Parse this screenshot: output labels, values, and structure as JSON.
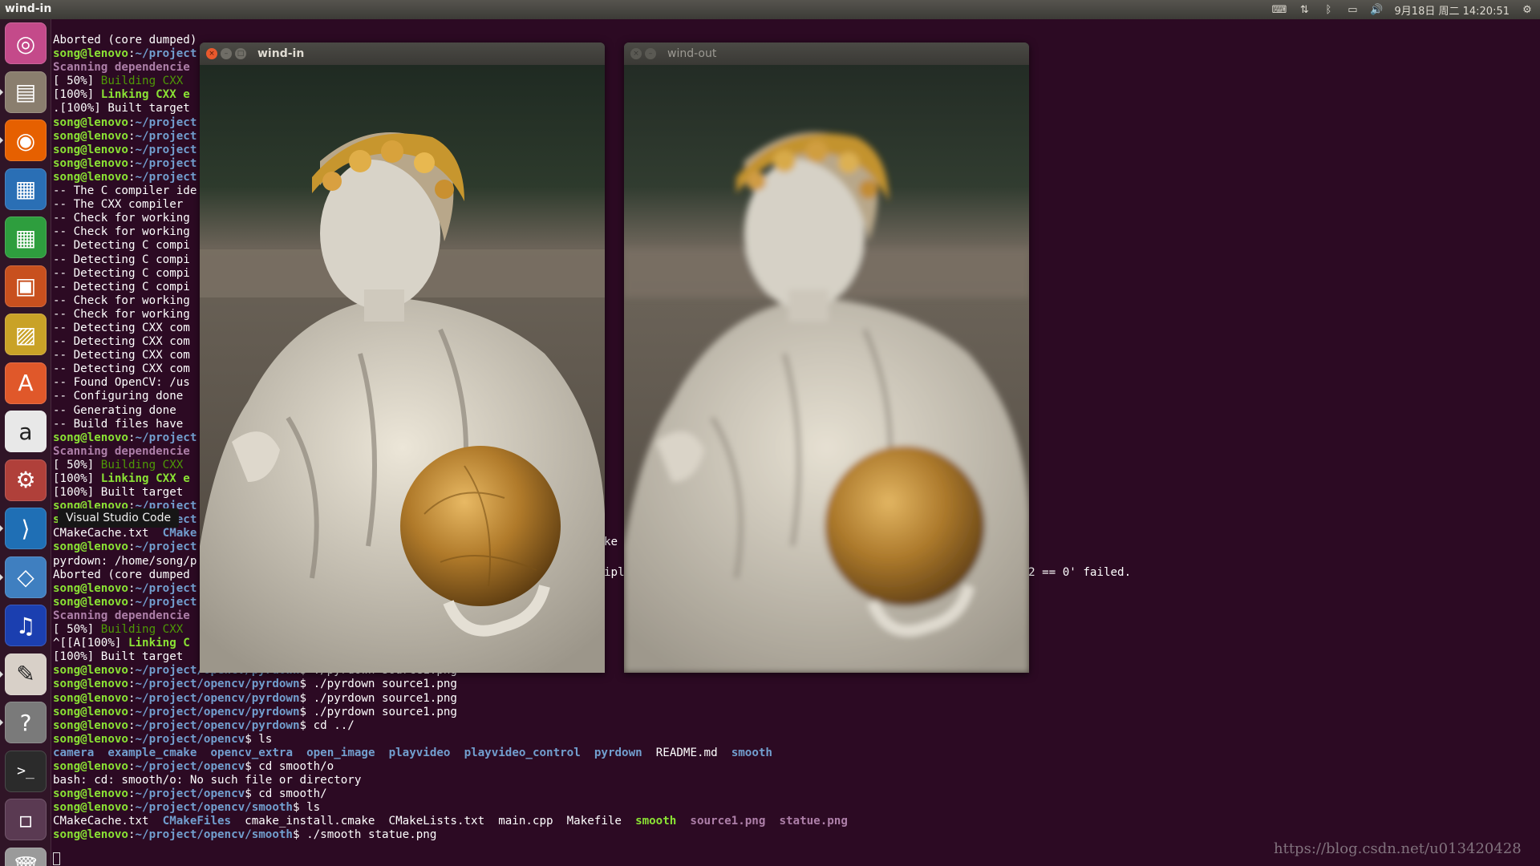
{
  "top_panel": {
    "app_title": "wind-in",
    "datetime": "9月18日 周二 14:20:51",
    "tray": [
      "keyboard-icon",
      "network-icon",
      "bluetooth-icon",
      "battery-icon",
      "volume-icon"
    ]
  },
  "launcher": {
    "items": [
      {
        "name": "ubuntu-dash",
        "icon": "ubuntu-logo-icon",
        "color": "#c44a8a"
      },
      {
        "name": "files",
        "icon": "file-cabinet-icon",
        "color": "#8a7e6e"
      },
      {
        "name": "firefox",
        "icon": "firefox-icon",
        "color": "#e66000"
      },
      {
        "name": "libreoffice-writer",
        "icon": "document-icon",
        "color": "#2a6fb5"
      },
      {
        "name": "libreoffice-calc",
        "icon": "spreadsheet-icon",
        "color": "#2e9e3e"
      },
      {
        "name": "libreoffice-impress",
        "icon": "presentation-icon",
        "color": "#c8501e"
      },
      {
        "name": "image-viewer",
        "icon": "picture-icon",
        "color": "#c9a227"
      },
      {
        "name": "software-center",
        "icon": "shopping-bag-icon",
        "color": "#e0582a"
      },
      {
        "name": "amazon",
        "icon": "amazon-icon",
        "color": "#e8e8e8"
      },
      {
        "name": "system-settings",
        "icon": "wrench-gear-icon",
        "color": "#b0403a"
      },
      {
        "name": "visual-studio-code",
        "icon": "vscode-icon",
        "color": "#1f6fb5"
      },
      {
        "name": "virtualbox",
        "icon": "cube-icon",
        "color": "#3f7fc0"
      },
      {
        "name": "audacity",
        "icon": "headphones-icon",
        "color": "#1b3fb0"
      },
      {
        "name": "pdf-viewer",
        "icon": "pdf-icon",
        "color": "#d8d0c8"
      },
      {
        "name": "help",
        "icon": "question-icon",
        "color": "#7a7a7a"
      },
      {
        "name": "terminal",
        "icon": "terminal-icon",
        "color": "#2b2b2b"
      },
      {
        "name": "workspaces",
        "icon": "workspace-icon",
        "color": "#5a3a52"
      },
      {
        "name": "trash",
        "icon": "trash-icon",
        "color": "#9a9a9a"
      }
    ],
    "tooltip": "Visual Studio Code"
  },
  "terminal": {
    "lines": [
      [
        {
          "t": "Aborted (core dumped)"
        }
      ],
      [
        {
          "t": "song@lenovo",
          "c": "ps"
        },
        {
          "t": ":"
        },
        {
          "t": "~/project",
          "c": "pp"
        }
      ],
      [
        {
          "t": "Scanning dependencie",
          "c": "mag"
        }
      ],
      [
        {
          "t": "[ 50%] "
        },
        {
          "t": "Building CXX ",
          "c": "grn"
        }
      ],
      [
        {
          "t": "[100%] "
        },
        {
          "t": "Linking CXX e",
          "c": "grnb"
        }
      ],
      [
        {
          "t": ".[100%] Built target"
        }
      ],
      [
        {
          "t": "song@lenovo",
          "c": "ps"
        },
        {
          "t": ":"
        },
        {
          "t": "~/project",
          "c": "pp"
        }
      ],
      [
        {
          "t": "song@lenovo",
          "c": "ps"
        },
        {
          "t": ":"
        },
        {
          "t": "~/project",
          "c": "pp"
        }
      ],
      [
        {
          "t": "song@lenovo",
          "c": "ps"
        },
        {
          "t": ":"
        },
        {
          "t": "~/project",
          "c": "pp"
        }
      ],
      [
        {
          "t": "song@lenovo",
          "c": "ps"
        },
        {
          "t": ":"
        },
        {
          "t": "~/project",
          "c": "pp"
        }
      ],
      [
        {
          "t": "song@lenovo",
          "c": "ps"
        },
        {
          "t": ":"
        },
        {
          "t": "~/project",
          "c": "pp"
        }
      ],
      [
        {
          "t": "-- The C compiler ide"
        }
      ],
      [
        {
          "t": "-- The CXX compiler "
        }
      ],
      [
        {
          "t": "-- Check for working"
        }
      ],
      [
        {
          "t": "-- Check for working"
        }
      ],
      [
        {
          "t": "-- Detecting C compi"
        }
      ],
      [
        {
          "t": "-- Detecting C compi"
        }
      ],
      [
        {
          "t": "-- Detecting C compi"
        }
      ],
      [
        {
          "t": "-- Detecting C compi"
        }
      ],
      [
        {
          "t": "-- Check for working"
        }
      ],
      [
        {
          "t": "-- Check for working"
        }
      ],
      [
        {
          "t": "-- Detecting CXX com"
        }
      ],
      [
        {
          "t": "-- Detecting CXX com"
        }
      ],
      [
        {
          "t": "-- Detecting CXX com"
        }
      ],
      [
        {
          "t": "-- Detecting CXX com"
        }
      ],
      [
        {
          "t": "-- Found OpenCV: /us"
        }
      ],
      [
        {
          "t": "-- Configuring done"
        }
      ],
      [
        {
          "t": "-- Generating done"
        }
      ],
      [
        {
          "t": "-- Build files have "
        }
      ],
      [
        {
          "t": "song@lenovo",
          "c": "ps"
        },
        {
          "t": ":"
        },
        {
          "t": "~/project",
          "c": "pp"
        }
      ],
      [
        {
          "t": "Scanning dependencie",
          "c": "mag"
        }
      ],
      [
        {
          "t": "[ 50%] "
        },
        {
          "t": "Building CXX ",
          "c": "grn"
        }
      ],
      [
        {
          "t": "[100%] "
        },
        {
          "t": "Linking CXX e",
          "c": "grnb"
        }
      ],
      [
        {
          "t": "[100%] Built target "
        }
      ],
      [
        {
          "t": "song@lenovo",
          "c": "ps"
        },
        {
          "t": ":"
        },
        {
          "t": "~/project",
          "c": "pp"
        }
      ],
      [
        {
          "t": "song@lenovo",
          "c": "ps"
        },
        {
          "t": ":"
        },
        {
          "t": "~/project",
          "c": "pp"
        }
      ],
      [
        {
          "t": "CMakeCache.txt  "
        },
        {
          "t": "CMake",
          "c": "blu"
        }
      ],
      [
        {
          "t": "song@lenovo",
          "c": "ps"
        },
        {
          "t": ":"
        },
        {
          "t": "~/project",
          "c": "pp"
        }
      ],
      [
        {
          "t": "pyrdown: /home/song/p"
        }
      ],
      [
        {
          "t": "Aborted (core dumped"
        }
      ],
      [
        {
          "t": "song@lenovo",
          "c": "ps"
        },
        {
          "t": ":"
        },
        {
          "t": "~/project",
          "c": "pp"
        }
      ],
      [
        {
          "t": "song@lenovo",
          "c": "ps"
        },
        {
          "t": ":"
        },
        {
          "t": "~/project",
          "c": "pp"
        }
      ],
      [
        {
          "t": "Scanning dependencie",
          "c": "mag"
        }
      ],
      [
        {
          "t": "[ 50%] "
        },
        {
          "t": "Building CXX ",
          "c": "grn"
        }
      ],
      [
        {
          "t": "^[[A[100%] "
        },
        {
          "t": "Linking C",
          "c": "grnb"
        }
      ],
      [
        {
          "t": "[100%] Built target "
        }
      ],
      [
        {
          "t": "song@lenovo",
          "c": "ps"
        },
        {
          "t": ":"
        },
        {
          "t": "~/project/opencv/pyrdown",
          "c": "pp"
        },
        {
          "t": "$ ./pyrdown source1.png"
        }
      ],
      [
        {
          "t": "song@lenovo",
          "c": "ps"
        },
        {
          "t": ":"
        },
        {
          "t": "~/project/opencv/pyrdown",
          "c": "pp"
        },
        {
          "t": "$ ./pyrdown source1.png"
        }
      ],
      [
        {
          "t": "song@lenovo",
          "c": "ps"
        },
        {
          "t": ":"
        },
        {
          "t": "~/project/opencv/pyrdown",
          "c": "pp"
        },
        {
          "t": "$ ./pyrdown source1.png"
        }
      ],
      [
        {
          "t": "song@lenovo",
          "c": "ps"
        },
        {
          "t": ":"
        },
        {
          "t": "~/project/opencv/pyrdown",
          "c": "pp"
        },
        {
          "t": "$ ./pyrdown source1.png"
        }
      ],
      [
        {
          "t": "song@lenovo",
          "c": "ps"
        },
        {
          "t": ":"
        },
        {
          "t": "~/project/opencv/pyrdown",
          "c": "pp"
        },
        {
          "t": "$ cd ../"
        }
      ],
      [
        {
          "t": "song@lenovo",
          "c": "ps"
        },
        {
          "t": ":"
        },
        {
          "t": "~/project/opencv",
          "c": "pp"
        },
        {
          "t": "$ ls"
        }
      ],
      [
        {
          "t": "camera",
          "c": "blu"
        },
        {
          "t": "  "
        },
        {
          "t": "example_cmake",
          "c": "blu"
        },
        {
          "t": "  "
        },
        {
          "t": "opencv_extra",
          "c": "blu"
        },
        {
          "t": "  "
        },
        {
          "t": "open_image",
          "c": "blu"
        },
        {
          "t": "  "
        },
        {
          "t": "playvideo",
          "c": "blu"
        },
        {
          "t": "  "
        },
        {
          "t": "playvideo_control",
          "c": "blu"
        },
        {
          "t": "  "
        },
        {
          "t": "pyrdown",
          "c": "blu"
        },
        {
          "t": "  README.md  "
        },
        {
          "t": "smooth",
          "c": "blu"
        }
      ],
      [
        {
          "t": "song@lenovo",
          "c": "ps"
        },
        {
          "t": ":"
        },
        {
          "t": "~/project/opencv",
          "c": "pp"
        },
        {
          "t": "$ cd smooth/o"
        }
      ],
      [
        {
          "t": "bash: cd: smooth/o: No such file or directory"
        }
      ],
      [
        {
          "t": "song@lenovo",
          "c": "ps"
        },
        {
          "t": ":"
        },
        {
          "t": "~/project/opencv",
          "c": "pp"
        },
        {
          "t": "$ cd smooth/"
        }
      ],
      [
        {
          "t": "song@lenovo",
          "c": "ps"
        },
        {
          "t": ":"
        },
        {
          "t": "~/project/opencv/smooth",
          "c": "pp"
        },
        {
          "t": "$ ls"
        }
      ],
      [
        {
          "t": "CMakeCache.txt  "
        },
        {
          "t": "CMakeFiles",
          "c": "blu"
        },
        {
          "t": "  cmake_install.cmake  CMakeLists.txt  main.cpp  Makefile  "
        },
        {
          "t": "smooth",
          "c": "grnb"
        },
        {
          "t": "  "
        },
        {
          "t": "source1.png",
          "c": "mag"
        },
        {
          "t": "  "
        },
        {
          "t": "statue.png",
          "c": "mag"
        }
      ],
      [
        {
          "t": "song@lenovo",
          "c": "ps"
        },
        {
          "t": ":"
        },
        {
          "t": "~/project/opencv/smooth",
          "c": "pp"
        },
        {
          "t": "$ ./smooth statue.png"
        }
      ]
    ],
    "fragments": {
      "frag1": "ke",
      "frag2": "ipl",
      "frag3": "2 == 0' failed."
    }
  },
  "windows": {
    "in": {
      "title": "wind-in"
    },
    "out": {
      "title": "wind-out"
    }
  },
  "watermark": "https://blog.csdn.net/u013420428"
}
